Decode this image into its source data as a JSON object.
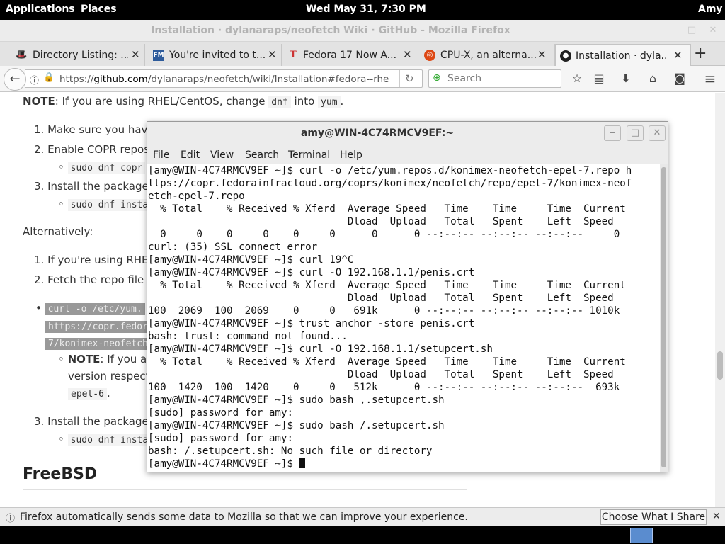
{
  "panel": {
    "applications": "Applications",
    "places": "Places",
    "clock": "Wed May 31,  7:30 PM",
    "user": "Amy"
  },
  "firefox": {
    "title": "Installation · dylanaraps/neofetch Wiki · GitHub - Mozilla Firefox",
    "tabs": [
      {
        "label": "Directory Listing: ...",
        "icon": "fedora-icon"
      },
      {
        "label": "You're invited to t...",
        "icon": "fm-icon"
      },
      {
        "label": "Fedora 17 Now A...",
        "icon": "t-icon"
      },
      {
        "label": "CPU-X, an alterna...",
        "icon": "ubuntu-icon"
      },
      {
        "label": "Installation · dyla...",
        "icon": "github-icon"
      }
    ],
    "url_prefix": "https://",
    "url_domain": "github.com",
    "url_rest": "/dylanaraps/neofetch/wiki/Installation#fedora--rhe",
    "search_placeholder": "Search"
  },
  "page": {
    "note_prefix": "NOTE",
    "note_text": ": If you are using RHEL/CentOS, change",
    "note_code1": "dnf",
    "note_mid": "into",
    "note_code2": "yum",
    "note_end": ".",
    "step1": "1. Make sure you have",
    "step2": "2. Enable COPR repos",
    "step2_code": "sudo dnf copr",
    "step3": "3. Install the package",
    "step3_code": "sudo dnf insta",
    "alternatively": "Alternatively:",
    "alt1": "1. If you're using RHEL",
    "alt2": "2. Fetch the repo file",
    "curl_line1": "curl -o /etc/yum.",
    "curl_line2": "https://copr.fedor",
    "curl_line3": "7/konimex-neofetch",
    "sub_note_bold": "NOTE",
    "sub_note_text": ": If you ar",
    "sub_note_line2": "version respecti",
    "sub_note_code": "epel-6",
    "sub_note_end": ".",
    "alt3": "3. Install the package",
    "alt3_code": "sudo dnf insta",
    "freebsd": "FreeBSD"
  },
  "notification": {
    "text": "Firefox automatically sends some data to Mozilla so that we can improve your experience.",
    "button": "Choose What I Share"
  },
  "terminal": {
    "title": "amy@WIN-4C74RMCV9EF:~",
    "menu": [
      "File",
      "Edit",
      "View",
      "Search",
      "Terminal",
      "Help"
    ],
    "lines": [
      "[amy@WIN-4C74RMCV9EF ~]$ curl -o /etc/yum.repos.d/konimex-neofetch-epel-7.repo h",
      "ttps://copr.fedorainfracloud.org/coprs/konimex/neofetch/repo/epel-7/konimex-neof",
      "etch-epel-7.repo",
      "  % Total    % Received % Xferd  Average Speed   Time    Time     Time  Current",
      "                                 Dload  Upload   Total   Spent    Left  Speed",
      "  0     0    0     0    0     0      0      0 --:--:-- --:--:-- --:--:--     0",
      "curl: (35) SSL connect error",
      "[amy@WIN-4C74RMCV9EF ~]$ curl 19^C",
      "[amy@WIN-4C74RMCV9EF ~]$ curl -O 192.168.1.1/penis.crt",
      "  % Total    % Received % Xferd  Average Speed   Time    Time     Time  Current",
      "                                 Dload  Upload   Total   Spent    Left  Speed",
      "100  2069  100  2069    0     0   691k      0 --:--:-- --:--:-- --:--:-- 1010k",
      "[amy@WIN-4C74RMCV9EF ~]$ trust anchor -store penis.crt",
      "bash: trust: command not found...",
      "[amy@WIN-4C74RMCV9EF ~]$ curl -O 192.168.1.1/setupcert.sh",
      "  % Total    % Received % Xferd  Average Speed   Time    Time     Time  Current",
      "                                 Dload  Upload   Total   Spent    Left  Speed",
      "100  1420  100  1420    0     0   512k      0 --:--:-- --:--:-- --:--:--  693k",
      "[amy@WIN-4C74RMCV9EF ~]$ sudo bash ,.setupcert.sh",
      "[sudo] password for amy:",
      "[amy@WIN-4C74RMCV9EF ~]$ sudo bash /.setupcert.sh",
      "[sudo] password for amy:",
      "bash: /.setupcert.sh: No such file or directory",
      "[amy@WIN-4C74RMCV9EF ~]$ "
    ]
  }
}
